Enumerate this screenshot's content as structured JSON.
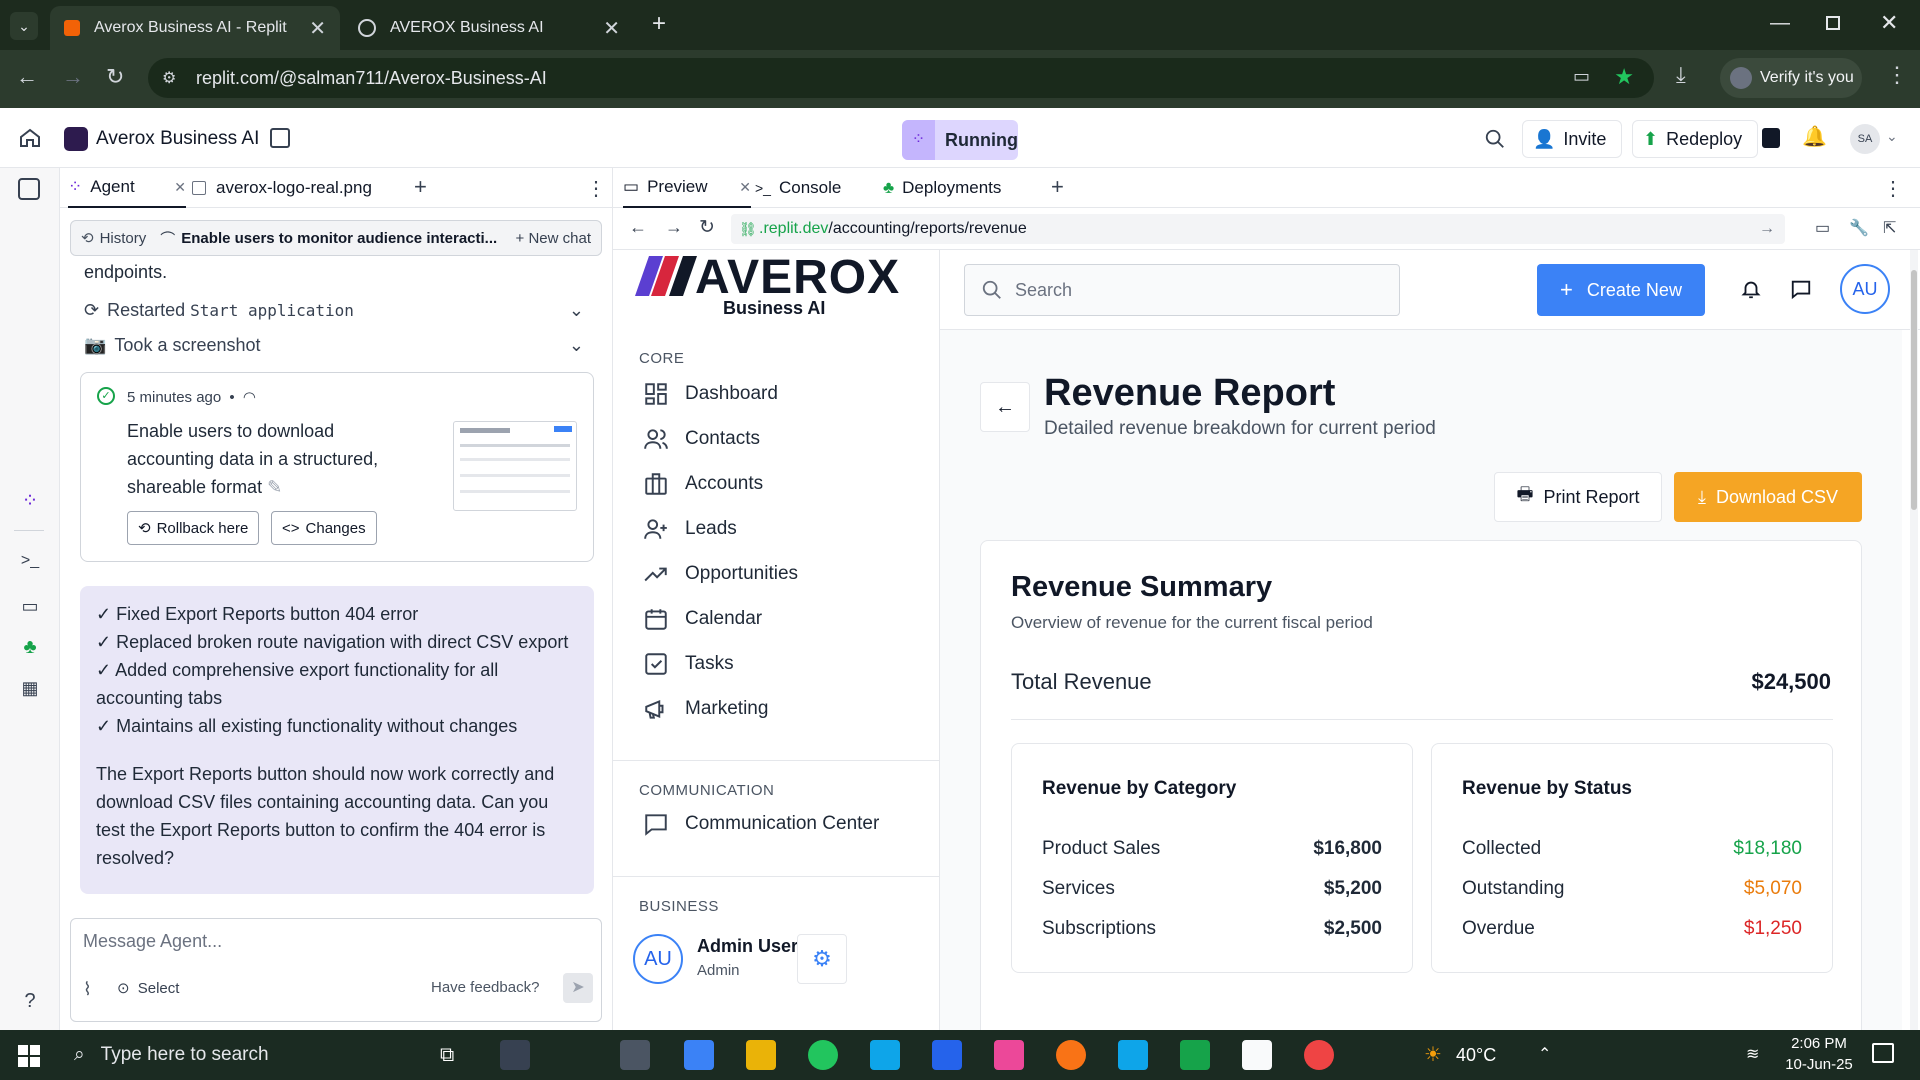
{
  "browser": {
    "tabs": [
      {
        "title": "Averox Business AI - Replit",
        "active": true
      },
      {
        "title": "AVEROX Business AI",
        "active": false
      }
    ],
    "url": "replit.com/@salman711/Averox-Business-AI",
    "verify_label": "Verify it's you"
  },
  "replit": {
    "project_name": "Averox Business AI",
    "status": "Running",
    "invite": "Invite",
    "redeploy": "Redeploy",
    "avatar": "SA"
  },
  "agent_panel": {
    "tabs": [
      "Agent",
      "averox-logo-real.png"
    ],
    "history": "History",
    "chat_title": "Enable users to monitor audience interacti...",
    "new_chat": "New chat",
    "endpoints_text": "endpoints.",
    "restarted_prefix": "Restarted",
    "restarted_code": "Start application",
    "screenshot": "Took a screenshot",
    "checkpoint": {
      "time": "5 minutes ago",
      "bullet": "•",
      "description": "Enable users to download accounting data in a structured, shareable format",
      "rollback": "Rollback here",
      "changes": "Changes"
    },
    "message_lines": [
      "✓ Fixed Export Reports button 404 error",
      "✓ Replaced broken route navigation with direct CSV export",
      "✓ Added comprehensive export functionality for all accounting tabs",
      "✓ Maintains all existing functionality without changes"
    ],
    "message_paragraph": "The Export Reports button should now work correctly and download CSV files containing accounting data. Can you test the Export Reports button to confirm the 404 error is resolved?",
    "input_placeholder": "Message Agent...",
    "select": "Select",
    "feedback": "Have feedback?"
  },
  "preview_panel": {
    "tabs": [
      "Preview",
      "Console",
      "Deployments"
    ],
    "url_host": ".replit.dev",
    "url_path": "/accounting/reports/revenue"
  },
  "app": {
    "logo_text": "AVEROX",
    "logo_sub": "Business AI",
    "search_placeholder": "Search",
    "create_new": "Create New",
    "avatar": "AU",
    "sections": {
      "core": "CORE",
      "communication": "COMMUNICATION",
      "business": "BUSINESS"
    },
    "nav": [
      {
        "label": "Dashboard",
        "icon": "dashboard-icon"
      },
      {
        "label": "Contacts",
        "icon": "contacts-icon"
      },
      {
        "label": "Accounts",
        "icon": "accounts-icon"
      },
      {
        "label": "Leads",
        "icon": "leads-icon"
      },
      {
        "label": "Opportunities",
        "icon": "opportunities-icon"
      },
      {
        "label": "Calendar",
        "icon": "calendar-icon"
      },
      {
        "label": "Tasks",
        "icon": "tasks-icon"
      },
      {
        "label": "Marketing",
        "icon": "marketing-icon"
      }
    ],
    "comm_nav": {
      "label": "Communication Center",
      "icon": "chat-icon"
    },
    "user": {
      "initials": "AU",
      "name": "Admin User",
      "role": "Admin"
    },
    "page": {
      "title": "Revenue Report",
      "subtitle": "Detailed revenue breakdown for current period",
      "print": "Print Report",
      "download": "Download CSV"
    },
    "summary": {
      "title": "Revenue Summary",
      "subtitle": "Overview of revenue for the current fiscal period",
      "total_label": "Total Revenue",
      "total_value": "$24,500"
    },
    "by_category": {
      "title": "Revenue by Category",
      "rows": [
        {
          "label": "Product Sales",
          "value": "$16,800"
        },
        {
          "label": "Services",
          "value": "$5,200"
        },
        {
          "label": "Subscriptions",
          "value": "$2,500"
        }
      ]
    },
    "by_status": {
      "title": "Revenue by Status",
      "rows": [
        {
          "label": "Collected",
          "value": "$18,180",
          "color": "#16a34a"
        },
        {
          "label": "Outstanding",
          "value": "$5,070",
          "color": "#ea7c0c"
        },
        {
          "label": "Overdue",
          "value": "$1,250",
          "color": "#dc2626"
        }
      ]
    }
  },
  "taskbar": {
    "search_placeholder": "Type here to search",
    "weather": "40°C",
    "time": "2:06 PM",
    "date": "10-Jun-25"
  },
  "colors": {
    "accent_blue": "#3b82f6",
    "download_orange": "#f5a524",
    "running_purple": "#c4b5fd"
  }
}
